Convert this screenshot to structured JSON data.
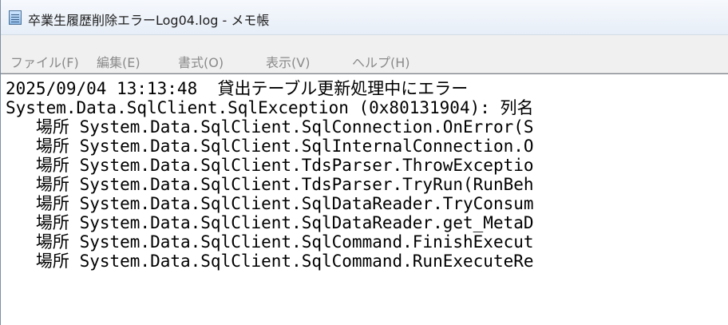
{
  "window": {
    "title": "卒業生履歴削除エラーLog04.log - メモ帳",
    "icon": "notepad-icon"
  },
  "menu": {
    "file": "ファイル(F)",
    "edit": "編集(E)",
    "format": "書式(O)",
    "view": "表示(V)",
    "help": "ヘルプ(H)"
  },
  "editor": {
    "lines": [
      "2025/09/04 13:13:48  貸出テーブル更新処理中にエラー",
      "System.Data.SqlClient.SqlException (0x80131904): 列名",
      "   場所 System.Data.SqlClient.SqlConnection.OnError(S",
      "   場所 System.Data.SqlClient.SqlInternalConnection.O",
      "   場所 System.Data.SqlClient.TdsParser.ThrowExceptio",
      "   場所 System.Data.SqlClient.TdsParser.TryRun(RunBeh",
      "   場所 System.Data.SqlClient.SqlDataReader.TryConsum",
      "   場所 System.Data.SqlClient.SqlDataReader.get_MetaD",
      "   場所 System.Data.SqlClient.SqlCommand.FinishExecut",
      "   場所 System.Data.SqlClient.SqlCommand.RunExecuteRe"
    ]
  },
  "colors": {
    "title_bar": "#e7eef7",
    "menu_bar": "#f0f0f0",
    "menu_text_disabled": "#8a8a8a",
    "editor_background": "#ffffff",
    "editor_text": "#000000"
  }
}
